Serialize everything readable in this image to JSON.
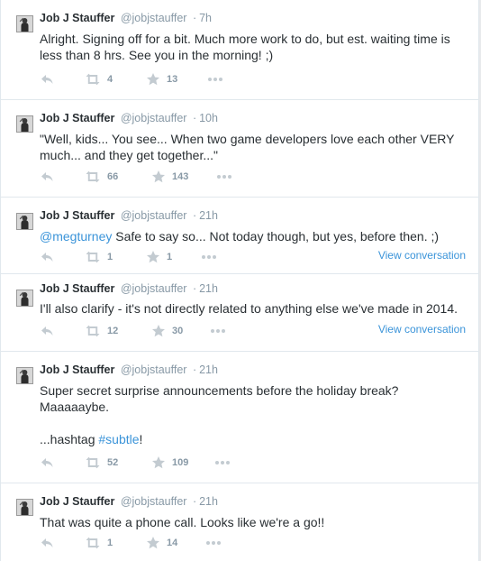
{
  "tweets": [
    {
      "name": "Job J Stauffer",
      "handle": "@jobjstauffer",
      "separator": "·",
      "time": "7h",
      "line1": "Alright. Signing off for a bit. Much more work to do, but est. waiting time is",
      "line2": "less than 8 hrs. See you in the morning! ;)",
      "retweets": "4",
      "favorites": "13"
    },
    {
      "name": "Job J Stauffer",
      "handle": "@jobjstauffer",
      "separator": "·",
      "time": "10h",
      "line1": "\"Well, kids... You see... When two game developers love each other VERY",
      "line2": "much... and they get together...\"",
      "retweets": "66",
      "favorites": "143"
    },
    {
      "name": "Job J Stauffer",
      "handle": "@jobjstauffer",
      "separator": "·",
      "time": "21h",
      "mention": "@megturney",
      "line1_rest": " Safe to say so... Not today though, but yes, before then. ;)",
      "retweets": "1",
      "favorites": "1",
      "view_conversation": "View conversation"
    },
    {
      "name": "Job J Stauffer",
      "handle": "@jobjstauffer",
      "separator": "·",
      "time": "21h",
      "line1": "I'll also clarify - it's not directly related to anything else we've made in 2014.",
      "retweets": "12",
      "favorites": "30",
      "view_conversation": "View conversation"
    },
    {
      "name": "Job J Stauffer",
      "handle": "@jobjstauffer",
      "separator": "·",
      "time": "21h",
      "line1": "Super secret surprise announcements before the holiday break?",
      "line2": "Maaaaaybe.",
      "line3_prefix": "...hashtag ",
      "hashtag": "#subtle",
      "line3_suffix": "!",
      "retweets": "52",
      "favorites": "109"
    },
    {
      "name": "Job J Stauffer",
      "handle": "@jobjstauffer",
      "separator": "·",
      "time": "21h",
      "line1": "That was quite a phone call. Looks like we're a go!!",
      "retweets": "1",
      "favorites": "14"
    }
  ],
  "icons": {
    "reply": "reply-icon",
    "retweet": "retweet-icon",
    "favorite": "star-icon",
    "more": "more-icon"
  },
  "colors": {
    "link": "#3b94d9",
    "meta": "#8899a6",
    "text": "#292f33",
    "icon": "#c3cbd1",
    "divider": "#e1e8ed"
  }
}
